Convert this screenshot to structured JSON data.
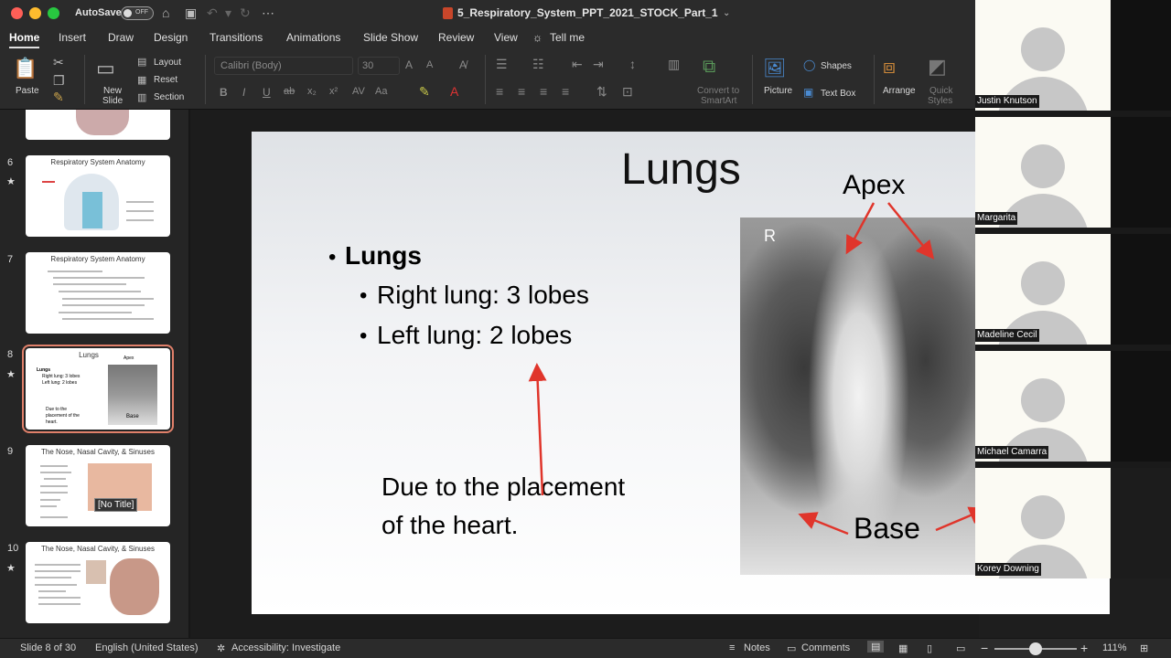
{
  "titlebar": {
    "autosave_label": "AutoSave",
    "autosave_state": "OFF",
    "document_title": "5_Respiratory_System_PPT_2021_STOCK_Part_1"
  },
  "menu_tabs": [
    "Home",
    "Insert",
    "Draw",
    "Design",
    "Transitions",
    "Animations",
    "Slide Show",
    "Review",
    "View"
  ],
  "tell_me": "Tell me",
  "ribbon": {
    "paste": "Paste",
    "new_slide_1": "New",
    "new_slide_2": "Slide",
    "layout": "Layout",
    "reset": "Reset",
    "section": "Section",
    "font_name": "Calibri (Body)",
    "font_size": "30",
    "convert_1": "Convert to",
    "convert_2": "SmartArt",
    "picture": "Picture",
    "shapes": "Shapes",
    "text_box": "Text Box",
    "arrange": "Arrange",
    "quick_1": "Quick",
    "quick_2": "Styles"
  },
  "slides_panel": [
    {
      "num": "6",
      "title": "Respiratory System Anatomy",
      "starred": true
    },
    {
      "num": "7",
      "title": "Respiratory System Anatomy",
      "starred": false
    },
    {
      "num": "8",
      "title": "Lungs",
      "starred": true,
      "selected": true
    },
    {
      "num": "9",
      "title": "The Nose, Nasal Cavity, & Sinuses",
      "starred": false
    },
    {
      "num": "10",
      "title": "The Nose, Nasal Cavity, & Sinuses",
      "starred": true
    }
  ],
  "thumb8": {
    "b1": "Lungs",
    "b2": "Right lung: 3 lobes",
    "b3": "Left lung: 2 lobes",
    "note": "Due to the placement of the heart.",
    "apex": "Apex",
    "base": "Base"
  },
  "thumb9_tooltip": "[No Title]",
  "slide": {
    "title": "Lungs",
    "bullet_1": "Lungs",
    "bullet_2": "Right lung: 3 lobes",
    "bullet_3": "Left lung: 2 lobes",
    "note": "Due to the placement of the heart.",
    "xray_marker": "R",
    "label_apex": "Apex",
    "label_base": "Base"
  },
  "participants": [
    "Justin Knutson",
    "Margarita",
    "Madeline Cecil",
    "Michael Camarra",
    "Korey Downing"
  ],
  "statusbar": {
    "slide_counter": "Slide 8 of 30",
    "language": "English (United States)",
    "accessibility": "Accessibility: Investigate",
    "notes": "Notes",
    "comments": "Comments",
    "zoom": "111%"
  },
  "colors": {
    "arrow_red": "#e0352b",
    "selected_outline": "#e0806a",
    "chrome": "#2b2b2b"
  }
}
